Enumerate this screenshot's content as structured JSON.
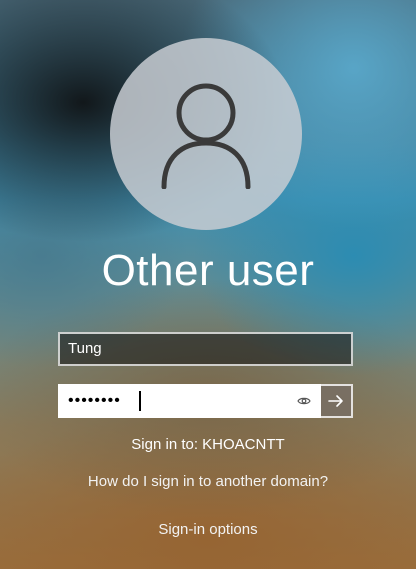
{
  "user": {
    "display_name": "Other user",
    "username_value": "Tung",
    "password_masked": "••••••••"
  },
  "signin": {
    "sign_in_to": "Sign in to: KHOACNTT",
    "domain_help": "How do I sign in to another domain?",
    "options": "Sign-in options"
  },
  "icons": {
    "avatar": "person-icon",
    "reveal": "eye-icon",
    "submit": "arrow-right-icon"
  }
}
